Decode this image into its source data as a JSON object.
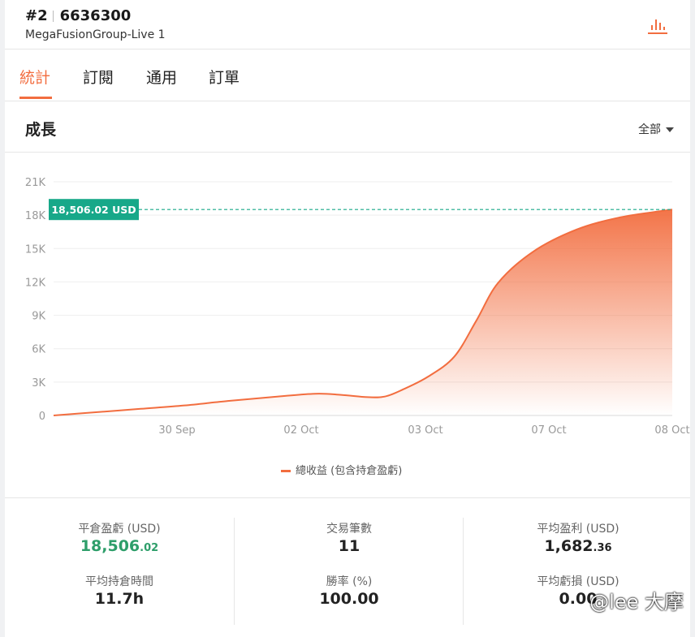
{
  "header": {
    "rank": "#2",
    "account_number": "6636300",
    "server": "MegaFusionGroup-Live 1",
    "icon": "bar-chart-icon"
  },
  "tabs": [
    {
      "label": "統計",
      "active": true
    },
    {
      "label": "訂閱",
      "active": false
    },
    {
      "label": "通用",
      "active": false
    },
    {
      "label": "訂單",
      "active": false
    }
  ],
  "section": {
    "title": "成長",
    "range": "全部"
  },
  "colors": {
    "accent": "#f26d3f",
    "badge": "#17a889",
    "positive": "#2e9e6a"
  },
  "chart_data": {
    "type": "area",
    "title": "",
    "xlabel": "",
    "ylabel": "",
    "ylim": [
      0,
      21000
    ],
    "y_ticks": [
      0,
      3000,
      6000,
      9000,
      12000,
      15000,
      18000,
      21000
    ],
    "y_tick_labels": [
      "0",
      "3K",
      "6K",
      "9K",
      "12K",
      "15K",
      "18K",
      "21K"
    ],
    "x_tick_labels": [
      "30 Sep",
      "02 Oct",
      "03 Oct",
      "07 Oct",
      "08 Oct"
    ],
    "grid": true,
    "legend": "bottom-center",
    "current_value_label": "18,506.02 USD",
    "current_value": 18506.02,
    "series": [
      {
        "name": "總收益 (包含持倉盈虧)",
        "points": [
          [
            0,
            0
          ],
          [
            0.5,
            300
          ],
          [
            1,
            600
          ],
          [
            1.5,
            900
          ],
          [
            2,
            1300
          ],
          [
            2.5,
            1650
          ],
          [
            3,
            1950
          ],
          [
            3.3,
            1850
          ],
          [
            3.6,
            1650
          ],
          [
            3.8,
            1700
          ],
          [
            4,
            2300
          ],
          [
            4.3,
            3500
          ],
          [
            4.6,
            5300
          ],
          [
            4.85,
            8500
          ],
          [
            5.1,
            11900
          ],
          [
            5.5,
            14700
          ],
          [
            6,
            16700
          ],
          [
            6.5,
            17800
          ],
          [
            7,
            18400
          ],
          [
            7.1,
            18506.02
          ]
        ]
      }
    ]
  },
  "stats": [
    [
      {
        "label": "平倉盈虧 (USD)",
        "int": "18,506",
        "dec": ".02",
        "positive": true
      },
      {
        "label": "平均持倉時間",
        "int": "11.7h",
        "dec": "",
        "positive": false
      }
    ],
    [
      {
        "label": "交易筆數",
        "int": "11",
        "dec": "",
        "positive": false
      },
      {
        "label": "勝率 (%)",
        "int": "100.00",
        "dec": "",
        "positive": false
      }
    ],
    [
      {
        "label": "平均盈利 (USD)",
        "int": "1,682",
        "dec": ".36",
        "positive": false
      },
      {
        "label": "平均虧損 (USD)",
        "int": "0.00",
        "dec": "",
        "positive": false
      }
    ]
  ],
  "watermark": "@lee 大摩"
}
